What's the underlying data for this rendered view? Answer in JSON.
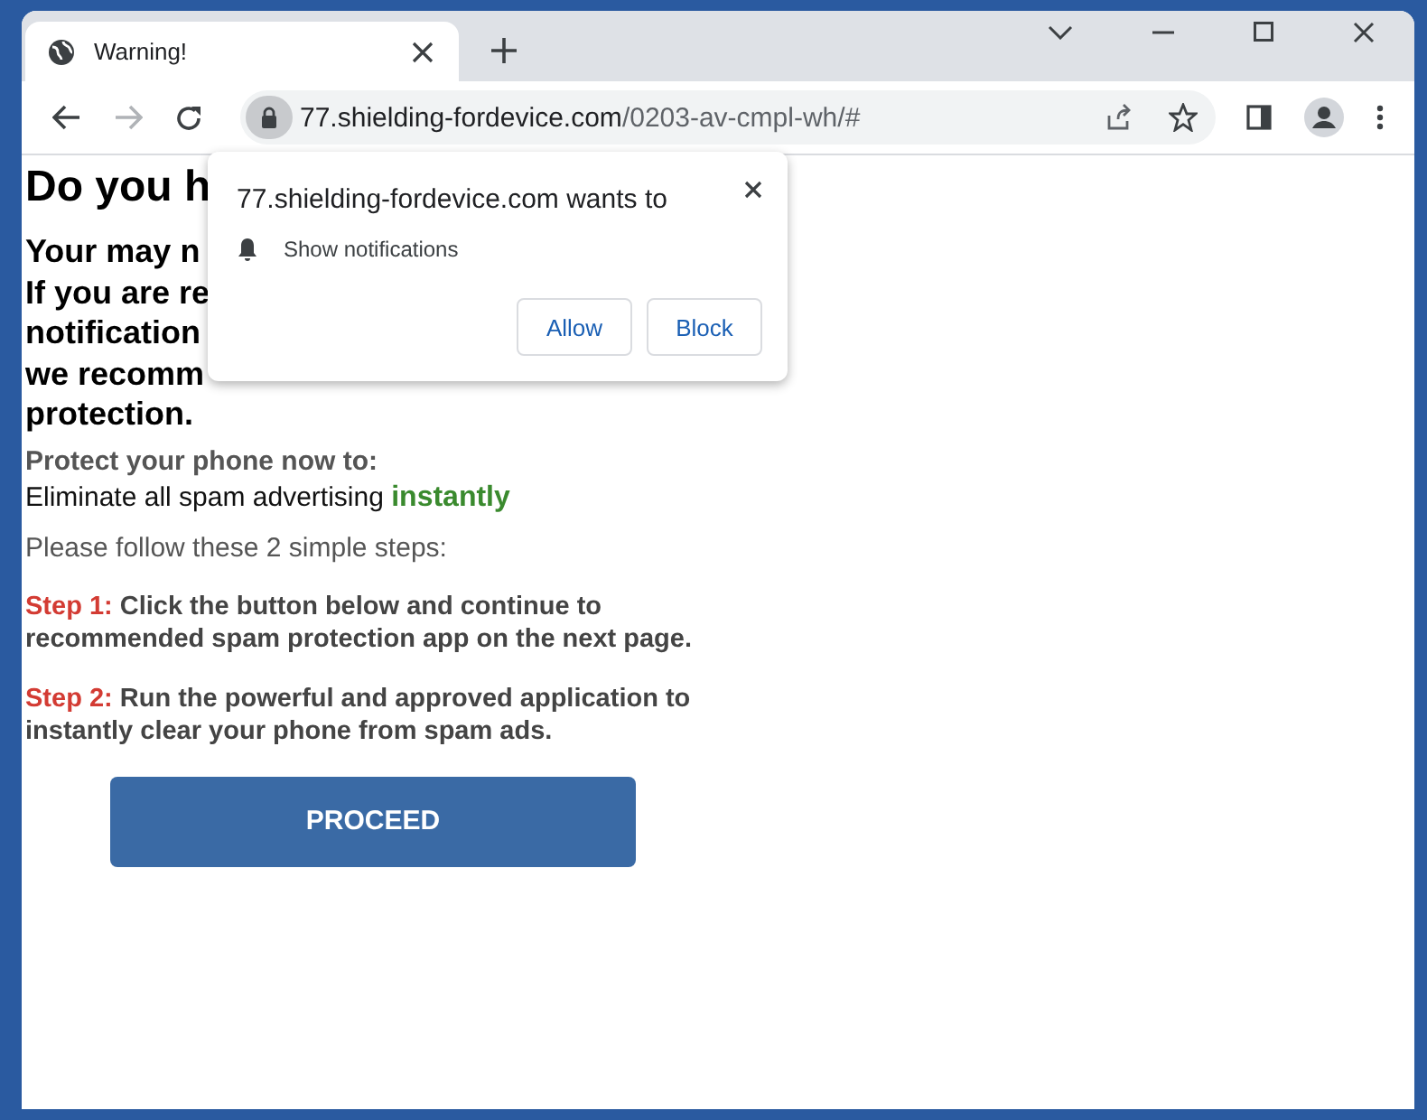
{
  "window": {
    "title": "Warning!"
  },
  "address_bar": {
    "host": "77.shielding-fordevice.com",
    "path": "/0203-av-cmpl-wh/#"
  },
  "page": {
    "heading": "Do you h",
    "warning_lines": [
      "Your may n",
      "If you are re",
      "notification",
      "we recomm",
      "protection."
    ],
    "protect_title": "Protect your phone now to:",
    "eliminate": {
      "text": "Eliminate all spam advertising",
      "highlight": "instantly"
    },
    "steps_intro": "Please follow these 2 simple steps:",
    "steps": [
      {
        "label": "Step 1:",
        "text": "Click the button below and continue to recommended spam protection app on the next page."
      },
      {
        "label": "Step 2:",
        "text": "Run the powerful and approved application to instantly clear your phone from spam ads."
      }
    ],
    "button": "PROCEED"
  },
  "permission_popup": {
    "title": "77.shielding-fordevice.com wants to",
    "permission": "Show notifications",
    "buttons": [
      "Allow",
      "Block"
    ]
  }
}
